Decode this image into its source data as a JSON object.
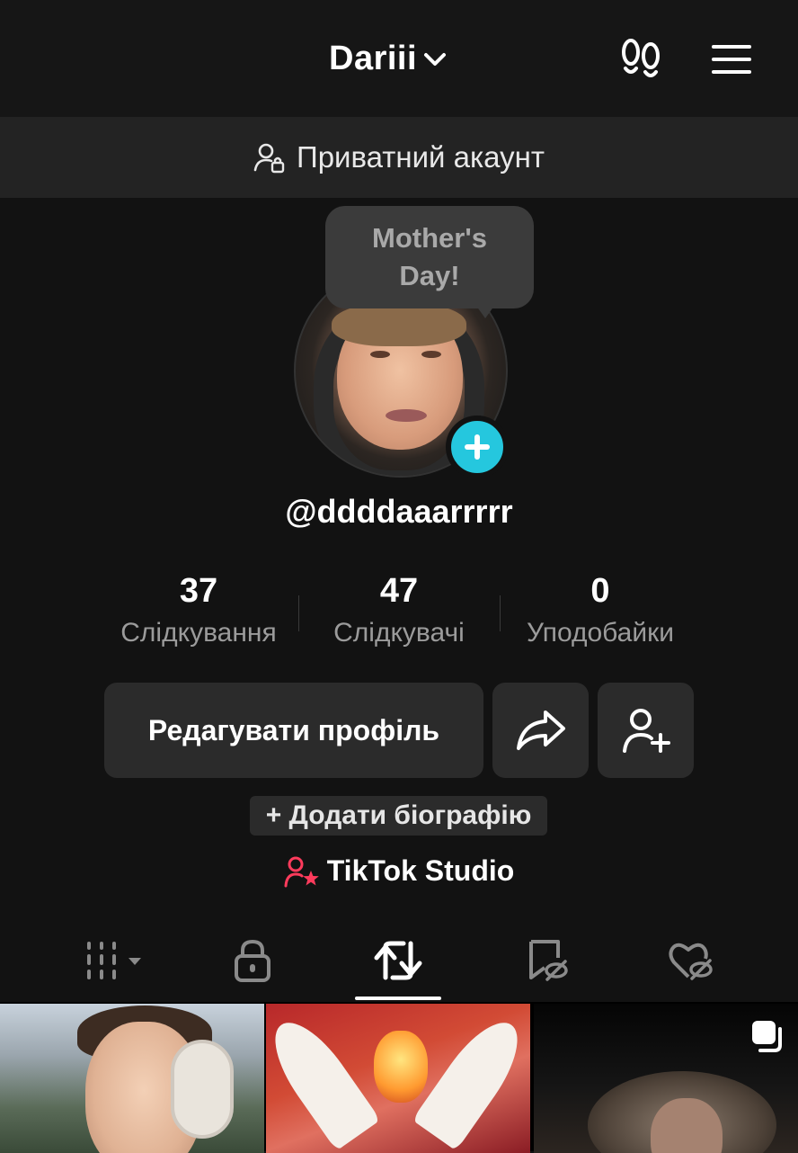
{
  "header": {
    "title": "Dariii",
    "icons": [
      "chevron-down-icon",
      "footsteps-icon",
      "hamburger-menu-icon"
    ]
  },
  "private_banner": {
    "label": "Приватний акаунт",
    "icon": "user-lock-icon"
  },
  "profile": {
    "note_bubble": "Mother's\nDay!",
    "username": "@ddddaaarrrrr",
    "avatar_badge_icon": "plus-icon",
    "accent_color": "#25c7de"
  },
  "stats": [
    {
      "value": "37",
      "label": "Слідкування"
    },
    {
      "value": "47",
      "label": "Слідкувачі"
    },
    {
      "value": "0",
      "label": "Уподобайки"
    }
  ],
  "actions": {
    "edit_label": "Редагувати профіль",
    "share_icon": "share-icon",
    "add_friend_icon": "add-user-icon"
  },
  "bio_button": "+ Додати біографію",
  "studio": {
    "label": "TikTok Studio",
    "icon": "user-star-icon",
    "icon_color": "#ff3b5c"
  },
  "tabs": [
    {
      "icon": "grid-icon",
      "active": false
    },
    {
      "icon": "lock-icon",
      "active": false
    },
    {
      "icon": "repost-icon",
      "active": true
    },
    {
      "icon": "bookmark-hidden-icon",
      "active": false
    },
    {
      "icon": "heart-hidden-icon",
      "active": false
    }
  ],
  "thumbnails": [
    {
      "content": "girl-with-headphones"
    },
    {
      "content": "animated-winged-character"
    },
    {
      "content": "woman-in-dark-room",
      "badge_icon": "multi-photo-icon"
    }
  ]
}
